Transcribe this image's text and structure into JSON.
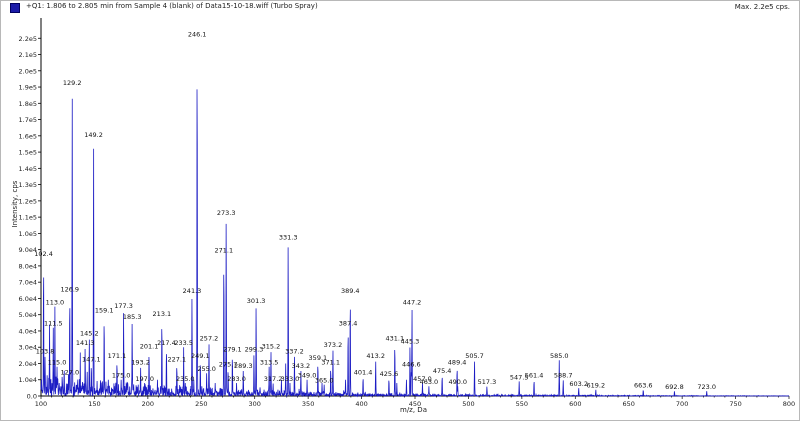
{
  "header": {
    "title": "+Q1: 1.806 to 2.805 min from Sample 4 (blank) of Data15-10-18.wiff (Turbo Spray)",
    "max": "Max. 2.2e5 cps."
  },
  "colors": {
    "trace": "#1c1cc4",
    "axis": "#000000",
    "legend": "#1a1aa8"
  },
  "chart_data": {
    "type": "line",
    "title": "+Q1: 1.806 to 2.805 min from Sample 4 (blank) of Data15-10-18.wiff (Turbo Spray)",
    "xlabel": "m/z, Da",
    "ylabel": "Intensity, cps",
    "xlim": [
      100,
      800
    ],
    "ylim": [
      0,
      230000
    ],
    "xticks": [
      100,
      150,
      200,
      250,
      300,
      350,
      400,
      450,
      500,
      550,
      600,
      650,
      700,
      750,
      800
    ],
    "yticks": [
      {
        "v": 0,
        "label": "0.0"
      },
      {
        "v": 10000,
        "label": "1.0e4"
      },
      {
        "v": 20000,
        "label": "2.0e4"
      },
      {
        "v": 30000,
        "label": "3.0e4"
      },
      {
        "v": 40000,
        "label": "4.0e4"
      },
      {
        "v": 50000,
        "label": "5.0e4"
      },
      {
        "v": 60000,
        "label": "6.0e4"
      },
      {
        "v": 70000,
        "label": "7.0e4"
      },
      {
        "v": 80000,
        "label": "8.0e4"
      },
      {
        "v": 90000,
        "label": "9.0e4"
      },
      {
        "v": 100000,
        "label": "1.0e5"
      },
      {
        "v": 110000,
        "label": "1.1e5"
      },
      {
        "v": 120000,
        "label": "1.2e5"
      },
      {
        "v": 130000,
        "label": "1.3e5"
      },
      {
        "v": 140000,
        "label": "1.4e5"
      },
      {
        "v": 150000,
        "label": "1.5e5"
      },
      {
        "v": 160000,
        "label": "1.6e5"
      },
      {
        "v": 170000,
        "label": "1.7e5"
      },
      {
        "v": 180000,
        "label": "1.8e5"
      },
      {
        "v": 190000,
        "label": "1.9e5"
      },
      {
        "v": 200000,
        "label": "2.0e5"
      },
      {
        "v": 210000,
        "label": "2.1e5"
      },
      {
        "v": 220000,
        "label": "2.2e5"
      }
    ],
    "peaks": [
      {
        "mz": 102.4,
        "i": 85000,
        "label": "102.4"
      },
      {
        "mz": 103.8,
        "i": 25000,
        "label": "103.8"
      },
      {
        "mz": 108.0,
        "i": 44000,
        "label": ""
      },
      {
        "mz": 111.5,
        "i": 42000,
        "label": "111.5"
      },
      {
        "mz": 113.0,
        "i": 55000,
        "label": "113.0"
      },
      {
        "mz": 115.0,
        "i": 18000,
        "label": "115.0"
      },
      {
        "mz": 117.0,
        "i": 8000,
        "label": ""
      },
      {
        "mz": 126.9,
        "i": 63000,
        "label": "126.9"
      },
      {
        "mz": 129.2,
        "i": 190000,
        "label": "129.2"
      },
      {
        "mz": 127.0,
        "i": 12000,
        "label": "127.0"
      },
      {
        "mz": 141.3,
        "i": 30000,
        "label": "141.3"
      },
      {
        "mz": 143.0,
        "i": 8000,
        "label": ""
      },
      {
        "mz": 145.2,
        "i": 36000,
        "label": "145.2"
      },
      {
        "mz": 147.1,
        "i": 20000,
        "label": "147.1"
      },
      {
        "mz": 149.2,
        "i": 158000,
        "label": "149.2"
      },
      {
        "mz": 159.1,
        "i": 50000,
        "label": "159.1"
      },
      {
        "mz": 163.0,
        "i": 10000,
        "label": ""
      },
      {
        "mz": 171.1,
        "i": 22000,
        "label": "171.1"
      },
      {
        "mz": 175.0,
        "i": 10000,
        "label": "175.0"
      },
      {
        "mz": 177.3,
        "i": 53000,
        "label": "177.3"
      },
      {
        "mz": 181.0,
        "i": 8000,
        "label": ""
      },
      {
        "mz": 185.3,
        "i": 46000,
        "label": "185.3"
      },
      {
        "mz": 193.2,
        "i": 18000,
        "label": "193.2"
      },
      {
        "mz": 197.0,
        "i": 8000,
        "label": "197.0"
      },
      {
        "mz": 201.1,
        "i": 28000,
        "label": "201.1"
      },
      {
        "mz": 209.0,
        "i": 10000,
        "label": ""
      },
      {
        "mz": 213.1,
        "i": 48000,
        "label": "213.1"
      },
      {
        "mz": 217.4,
        "i": 30000,
        "label": "217.4"
      },
      {
        "mz": 227.1,
        "i": 20000,
        "label": "227.1"
      },
      {
        "mz": 233.5,
        "i": 30000,
        "label": "233.5"
      },
      {
        "mz": 235.0,
        "i": 8000,
        "label": "235.0"
      },
      {
        "mz": 241.3,
        "i": 62000,
        "label": "241.3"
      },
      {
        "mz": 243.0,
        "i": 10000,
        "label": ""
      },
      {
        "mz": 246.1,
        "i": 220000,
        "label": "246.1"
      },
      {
        "mz": 249.1,
        "i": 22000,
        "label": "249.1"
      },
      {
        "mz": 255.0,
        "i": 14000,
        "label": "255.0"
      },
      {
        "mz": 257.2,
        "i": 33000,
        "label": "257.2"
      },
      {
        "mz": 263.0,
        "i": 8000,
        "label": ""
      },
      {
        "mz": 271.1,
        "i": 87000,
        "label": "271.1"
      },
      {
        "mz": 273.3,
        "i": 110000,
        "label": "273.3"
      },
      {
        "mz": 275.1,
        "i": 17000,
        "label": "275.7"
      },
      {
        "mz": 279.1,
        "i": 26000,
        "label": "279.1"
      },
      {
        "mz": 283.0,
        "i": 8000,
        "label": "283.0"
      },
      {
        "mz": 289.3,
        "i": 16000,
        "label": "289.3"
      },
      {
        "mz": 299.3,
        "i": 26000,
        "label": "299.3"
      },
      {
        "mz": 301.3,
        "i": 56000,
        "label": "301.3"
      },
      {
        "mz": 313.5,
        "i": 18000,
        "label": "313.5"
      },
      {
        "mz": 315.2,
        "i": 28000,
        "label": "315.2"
      },
      {
        "mz": 317.2,
        "i": 8000,
        "label": "317.2"
      },
      {
        "mz": 325.0,
        "i": 10000,
        "label": ""
      },
      {
        "mz": 329.0,
        "i": 20000,
        "label": ""
      },
      {
        "mz": 331.3,
        "i": 95000,
        "label": "331.3"
      },
      {
        "mz": 333.0,
        "i": 8000,
        "label": "333.0"
      },
      {
        "mz": 337.2,
        "i": 25000,
        "label": "337.2"
      },
      {
        "mz": 343.2,
        "i": 16000,
        "label": "343.2"
      },
      {
        "mz": 349.0,
        "i": 10000,
        "label": "349.0"
      },
      {
        "mz": 359.1,
        "i": 21000,
        "label": "359.1"
      },
      {
        "mz": 363.0,
        "i": 8000,
        "label": ""
      },
      {
        "mz": 365.0,
        "i": 7000,
        "label": "365.0"
      },
      {
        "mz": 371.1,
        "i": 18000,
        "label": "371.1"
      },
      {
        "mz": 373.2,
        "i": 29000,
        "label": "373.2"
      },
      {
        "mz": 385.0,
        "i": 10000,
        "label": ""
      },
      {
        "mz": 387.4,
        "i": 42000,
        "label": "387.4"
      },
      {
        "mz": 389.4,
        "i": 62000,
        "label": "389.4"
      },
      {
        "mz": 401.4,
        "i": 12000,
        "label": "401.4"
      },
      {
        "mz": 413.2,
        "i": 22000,
        "label": "413.2"
      },
      {
        "mz": 425.6,
        "i": 11000,
        "label": "425.6"
      },
      {
        "mz": 431.1,
        "i": 33000,
        "label": "431.1"
      },
      {
        "mz": 433.0,
        "i": 8000,
        "label": ""
      },
      {
        "mz": 442.0,
        "i": 10000,
        "label": ""
      },
      {
        "mz": 445.3,
        "i": 31000,
        "label": "445.3"
      },
      {
        "mz": 446.6,
        "i": 17000,
        "label": "446.6"
      },
      {
        "mz": 447.2,
        "i": 55000,
        "label": "447.2"
      },
      {
        "mz": 457.0,
        "i": 8000,
        "label": "457.0"
      },
      {
        "mz": 475.4,
        "i": 13000,
        "label": "475.4"
      },
      {
        "mz": 463.0,
        "i": 6000,
        "label": "463.0"
      },
      {
        "mz": 489.4,
        "i": 18000,
        "label": "489.4"
      },
      {
        "mz": 490.0,
        "i": 6000,
        "label": "490.0"
      },
      {
        "mz": 505.7,
        "i": 22000,
        "label": "505.7"
      },
      {
        "mz": 517.3,
        "i": 6000,
        "label": "517.3"
      },
      {
        "mz": 547.5,
        "i": 9000,
        "label": "547.5"
      },
      {
        "mz": 561.4,
        "i": 10000,
        "label": "561.4"
      },
      {
        "mz": 585.0,
        "i": 22000,
        "label": "585.0"
      },
      {
        "mz": 588.7,
        "i": 10000,
        "label": "588.7"
      },
      {
        "mz": 603.2,
        "i": 5000,
        "label": "603.2"
      },
      {
        "mz": 619.2,
        "i": 4000,
        "label": "619.2"
      },
      {
        "mz": 663.6,
        "i": 4000,
        "label": "663.6"
      },
      {
        "mz": 692.8,
        "i": 3000,
        "label": "692.8"
      },
      {
        "mz": 723.0,
        "i": 3000,
        "label": "723.0"
      }
    ]
  }
}
